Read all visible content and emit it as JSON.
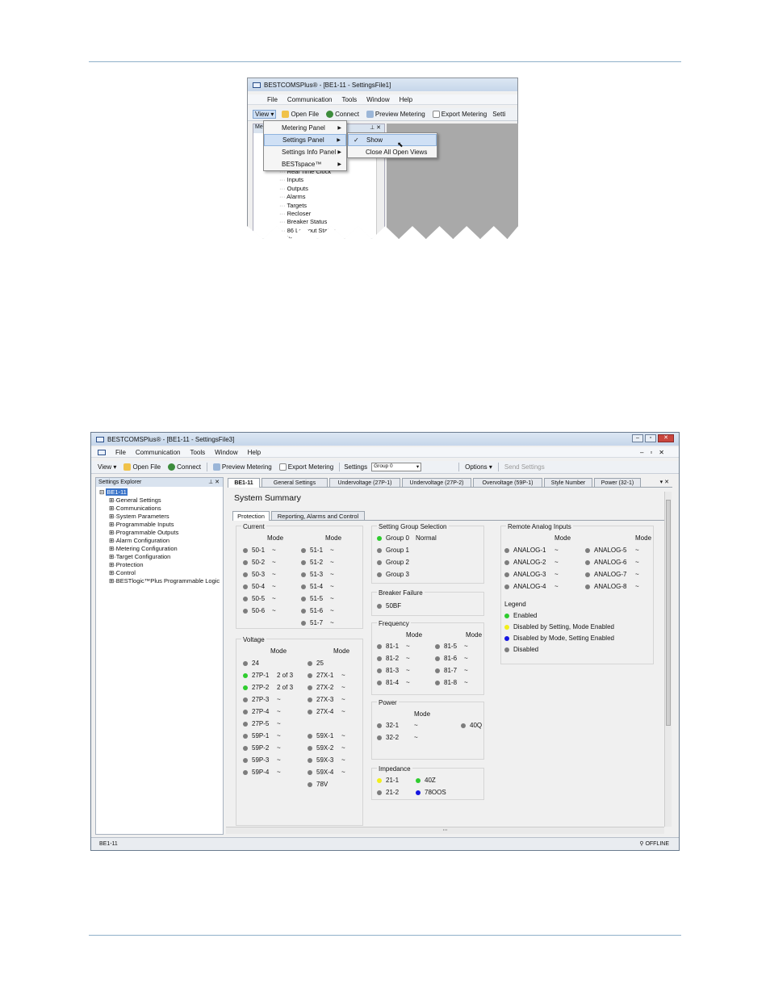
{
  "top_window": {
    "title": "BESTCOMSPlus® - [BE1-11 - SettingsFile1]",
    "menu": [
      "File",
      "Communication",
      "Tools",
      "Window",
      "Help"
    ],
    "toolbar": {
      "view": "View ▾",
      "open_file": "Open File",
      "connect": "Connect",
      "preview_metering": "Preview Metering",
      "export_metering": "Export Metering",
      "settings_trunc": "Setti"
    },
    "panel_stub": "Me",
    "view_menu": [
      "Metering Panel",
      "Settings Panel",
      "Settings Info Panel",
      "BESTspace™"
    ],
    "submenu": {
      "show": "Show",
      "close_all": "Close All Open Views"
    },
    "tree_items": [
      "Real Time Clock",
      "Inputs",
      "Outputs",
      "Alarms",
      "Targets",
      "Recloser",
      "Breaker Status",
      "86 Lockout Status",
      "ital Po"
    ]
  },
  "main_window": {
    "title": "BESTCOMSPlus® - [BE1-11 - SettingsFile3]",
    "menu": [
      "File",
      "Communication",
      "Tools",
      "Window",
      "Help"
    ],
    "toolbar": {
      "view": "View ▾",
      "open_file": "Open File",
      "connect": "Connect",
      "preview_metering": "Preview Metering",
      "export_metering": "Export Metering",
      "settings_label": "Settings",
      "group": "Group 0",
      "options": "Options ▾",
      "send_settings": "Send Settings"
    },
    "explorer": {
      "title": "Settings Explorer",
      "root": "BE1-11",
      "items": [
        "General Settings",
        "Communications",
        "System Parameters",
        "Programmable Inputs",
        "Programmable Outputs",
        "Alarm Configuration",
        "Metering Configuration",
        "Target Configuration",
        "Protection",
        "Control",
        "BESTlogic™Plus Programmable Logic"
      ]
    },
    "tabs": [
      "BE1-11",
      "General Settings",
      "Undervoltage (27P-1)",
      "Undervoltage (27P-2)",
      "Overvoltage (59P-1)",
      "Style Number",
      "Power (32-1)"
    ],
    "page_title": "System Summary",
    "subtabs": [
      "Protection",
      "Reporting, Alarms and Control"
    ],
    "current": {
      "title": "Current",
      "mode": "Mode",
      "left": [
        "50-1",
        "50-2",
        "50-3",
        "50-4",
        "50-5",
        "50-6"
      ],
      "right": [
        "51-1",
        "51-2",
        "51-3",
        "51-4",
        "51-5",
        "51-6",
        "51-7"
      ],
      "tilde": "~"
    },
    "voltage": {
      "title": "Voltage",
      "mode": "Mode",
      "left": [
        {
          "n": "24",
          "m": ""
        },
        {
          "n": "27P-1",
          "m": "2 of 3",
          "c": "g"
        },
        {
          "n": "27P-2",
          "m": "2 of 3",
          "c": "g"
        },
        {
          "n": "27P-3",
          "m": "~"
        },
        {
          "n": "27P-4",
          "m": "~"
        },
        {
          "n": "27P-5",
          "m": "~"
        },
        {
          "n": "59P-1",
          "m": "~"
        },
        {
          "n": "59P-2",
          "m": "~"
        },
        {
          "n": "59P-3",
          "m": "~"
        },
        {
          "n": "59P-4",
          "m": "~"
        }
      ],
      "right": [
        {
          "n": "25",
          "m": ""
        },
        {
          "n": "27X-1",
          "m": "~"
        },
        {
          "n": "27X-2",
          "m": "~"
        },
        {
          "n": "27X-3",
          "m": "~"
        },
        {
          "n": "27X-4",
          "m": "~"
        },
        null,
        {
          "n": "59X-1",
          "m": "~"
        },
        {
          "n": "59X-2",
          "m": "~"
        },
        {
          "n": "59X-3",
          "m": "~"
        },
        {
          "n": "59X-4",
          "m": "~"
        },
        {
          "n": "78V",
          "m": ""
        }
      ]
    },
    "setting_group": {
      "title": "Setting Group Selection",
      "items": [
        "Group 0",
        "Group 1",
        "Group 2",
        "Group 3"
      ],
      "normal": "Normal"
    },
    "breaker_failure": {
      "title": "Breaker Failure",
      "item": "50BF"
    },
    "frequency": {
      "title": "Frequency",
      "mode": "Mode",
      "left": [
        "81-1",
        "81-2",
        "81-3",
        "81-4"
      ],
      "right": [
        "81-5",
        "81-6",
        "81-7",
        "81-8"
      ]
    },
    "power": {
      "title": "Power",
      "mode": "Mode",
      "left": [
        "32-1",
        "32-2"
      ],
      "right": "40Q"
    },
    "impedance": {
      "title": "Impedance",
      "items": [
        {
          "n": "21-1",
          "c": "y"
        },
        {
          "n": "40Z",
          "c": "g"
        },
        {
          "n": "21-2",
          "c": ""
        },
        {
          "n": "78OOS",
          "c": "b"
        }
      ]
    },
    "remote_analog": {
      "title": "Remote Analog Inputs",
      "mode": "Mode",
      "left": [
        "ANALOG-1",
        "ANALOG-2",
        "ANALOG-3",
        "ANALOG-4"
      ],
      "right": [
        "ANALOG-5",
        "ANALOG-6",
        "ANALOG-7",
        "ANALOG-8"
      ]
    },
    "legend": {
      "title": "Legend",
      "items": [
        {
          "t": "Enabled",
          "c": "g"
        },
        {
          "t": "Disabled by Setting, Mode Enabled",
          "c": "y"
        },
        {
          "t": "Disabled by Mode, Setting Enabled",
          "c": "b"
        },
        {
          "t": "Disabled",
          "c": ""
        }
      ]
    },
    "status": {
      "left": "BE1-11",
      "right": "OFFLINE"
    }
  }
}
